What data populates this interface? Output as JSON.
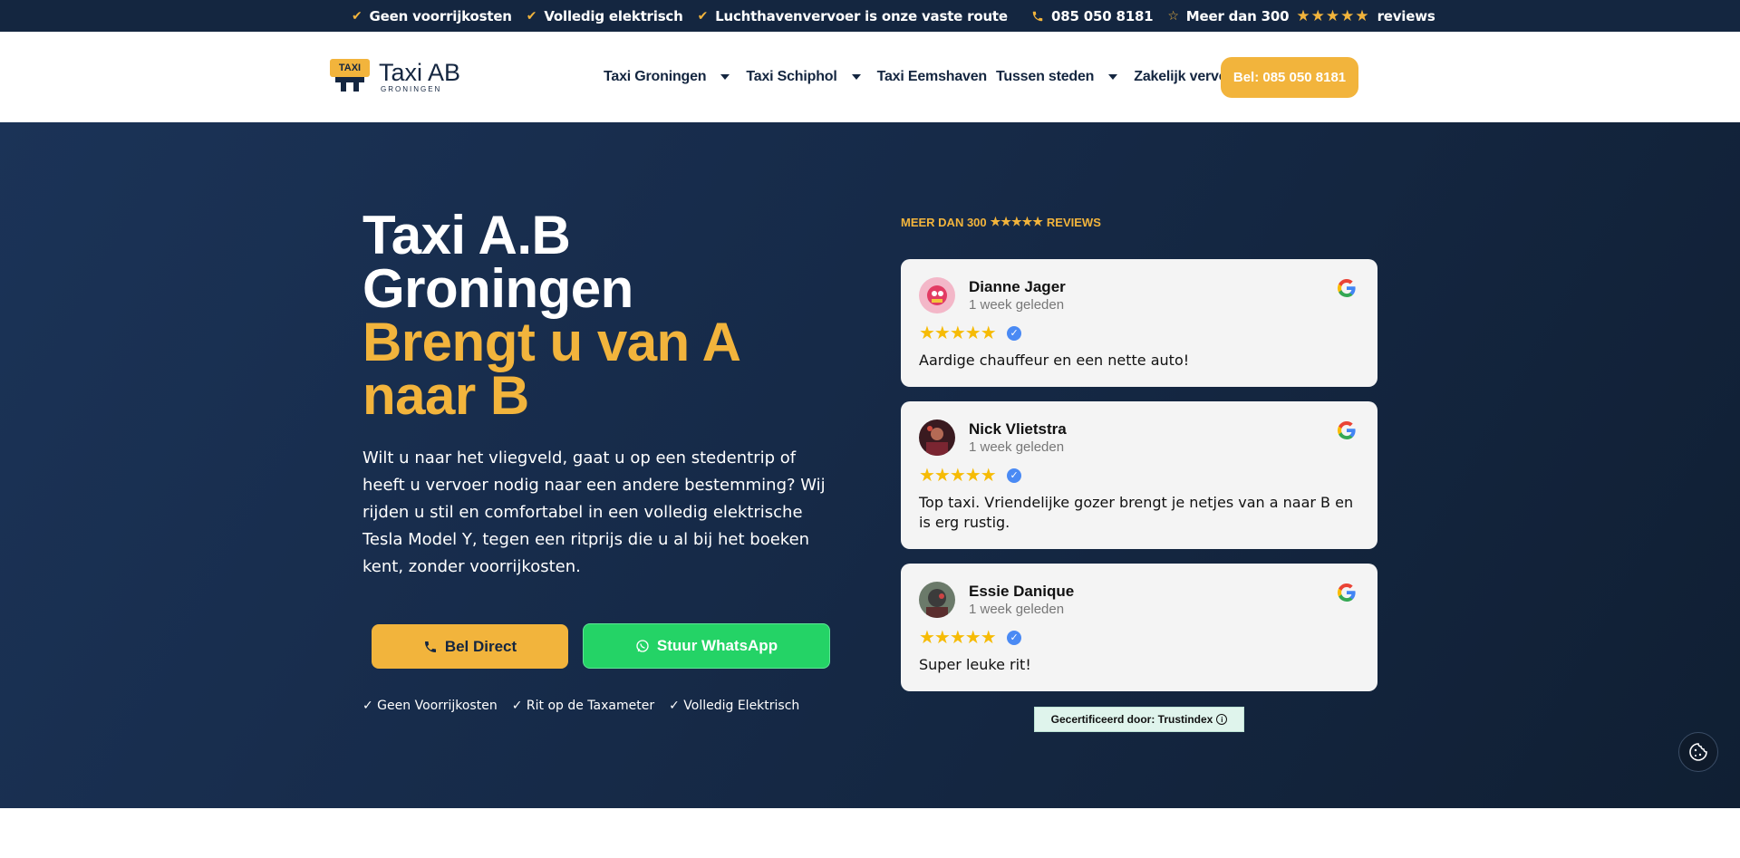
{
  "topbar": {
    "usp1": "Geen voorrijkosten",
    "usp2": "Volledig elektrisch",
    "usp3": "Luchthavenvervoer is onze vaste route",
    "phone": "085 050 8181",
    "reviews_prefix": "Meer dan 300",
    "reviews_stars": "★★★★★",
    "reviews_suffix": "reviews"
  },
  "logo": {
    "badge": "TAXI",
    "name": "Taxi AB",
    "sub": "GRONINGEN"
  },
  "nav": {
    "items": [
      {
        "label": "Taxi Groningen",
        "dropdown": true
      },
      {
        "label": "Taxi Schiphol",
        "dropdown": true
      },
      {
        "label": "Taxi Eemshaven",
        "dropdown": false
      },
      {
        "label": "Tussen steden",
        "dropdown": true
      },
      {
        "label": "Zakelijk vervoer",
        "dropdown": false
      }
    ],
    "call_button": "Bel: 085 050 8181"
  },
  "hero": {
    "title_line1": "Taxi A.B",
    "title_line2": "Groningen",
    "accent_line1": "Brengt u van A",
    "accent_line2": "naar B",
    "lead": "Wilt u naar het vliegveld, gaat u op een stedentrip of heeft u vervoer nodig naar een andere bestemming? Wij rijden u stil en comfortabel in een volledig elektrische Tesla Model Y, tegen een ritprijs die u al bij het boeken kent, zonder voorrijkosten.",
    "btn_call": "Bel Direct",
    "btn_whatsapp": "Stuur WhatsApp",
    "usps": [
      "✓ Geen Voorrijkosten",
      "✓ Rit op de Taxameter",
      "✓ Volledig Elektrisch"
    ]
  },
  "reviews": {
    "header_prefix": "MEER DAN 300",
    "header_stars": "★★★★★",
    "header_suffix": "REVIEWS",
    "items": [
      {
        "name": "Dianne Jager",
        "time": "1 week geleden",
        "stars": "★★★★★",
        "text": "Aardige chauffeur en een nette auto!"
      },
      {
        "name": "Nick Vlietstra",
        "time": "1 week geleden",
        "stars": "★★★★★",
        "text": "Top taxi. Vriendelijke gozer brengt je netjes van a naar B en is erg rustig."
      },
      {
        "name": "Essie Danique",
        "time": "1 week geleden",
        "stars": "★★★★★",
        "text": "Super leuke rit!"
      }
    ],
    "certified": "Gecertificeerd door: Trustindex"
  },
  "colors": {
    "navy": "#142640",
    "accent": "#f2b43c",
    "whatsapp": "#24d366"
  }
}
